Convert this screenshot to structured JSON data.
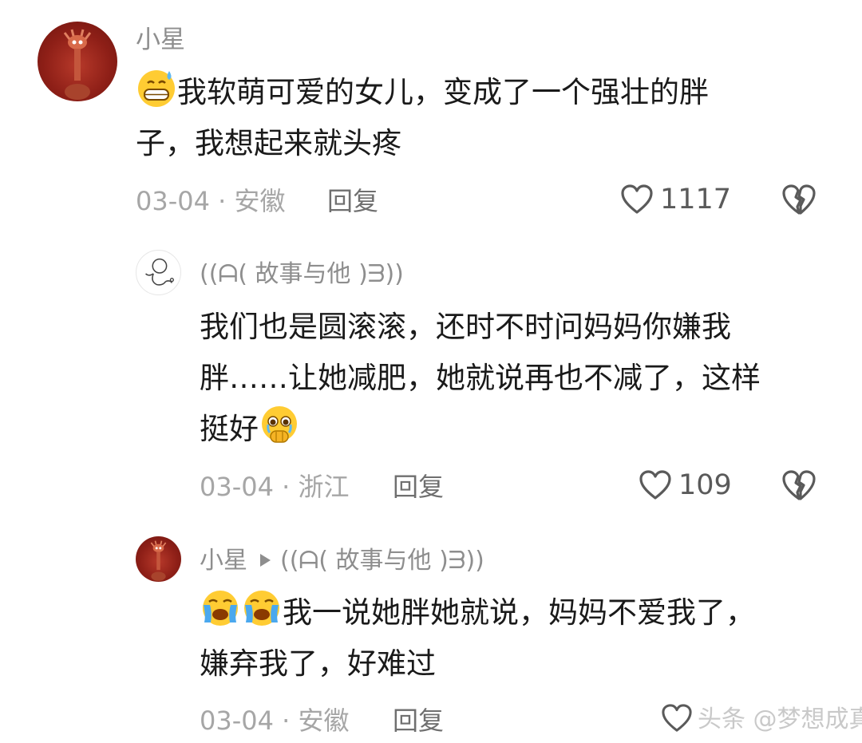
{
  "comments": [
    {
      "username": "小星",
      "text_line1": "我软萌可爱的女儿，变成了一个强壮的胖",
      "text_line2": "子，我想起来就头疼",
      "date": "03-04",
      "location": "安徽",
      "reply_label": "回复",
      "likes": "1117",
      "emoji": "grinning-sweat-emoji"
    },
    {
      "username": "((ᗩ( 故事与他 )ᗱ))",
      "text_line1": "我们也是圆滚滚，还时不时问妈妈你嫌我",
      "text_line2": "胖……让她减肥，她就说再也不减了，这样",
      "text_line3": "挺好",
      "date": "03-04",
      "location": "浙江",
      "reply_label": "回复",
      "likes": "109",
      "emoji": "holding-back-tears-emoji"
    },
    {
      "username": "小星",
      "reply_to": "((ᗩ( 故事与他 )ᗱ))",
      "text_line1": "我一说她胖她就说，妈妈不爱我了，",
      "text_line2": "嫌弃我了，好难过",
      "date": "03-04",
      "location": "安徽",
      "reply_label": "回复",
      "emoji": "loudly-crying-emoji"
    }
  ],
  "watermark_text": "头条 @梦想成真",
  "colors": {
    "text": "#1a1a1a",
    "meta": "#a6a6a6",
    "username": "#8e8e8e",
    "avatar_red": "#8e1f17"
  }
}
